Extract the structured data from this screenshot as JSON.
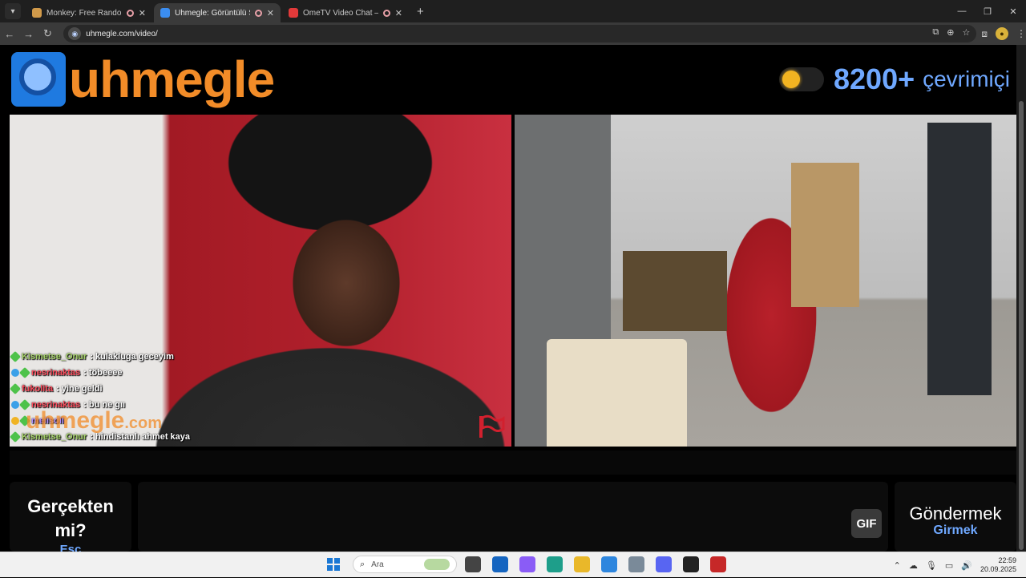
{
  "browser": {
    "tabs": [
      {
        "title": "Monkey: Free Random Vide",
        "favicon_color": "#d19a4a",
        "active": false
      },
      {
        "title": "Uhmegle: Görüntülü Sohbe",
        "favicon_color": "#3b8df0",
        "active": true
      },
      {
        "title": "OmeTV Video Chat — Ome",
        "favicon_color": "#e23a3a",
        "active": false
      }
    ],
    "url": "uhmegle.com/video/"
  },
  "header": {
    "logo_text": "uhmegle",
    "online_count": "8200+",
    "online_label": "çevrimiçi"
  },
  "videos": {
    "left_watermark": "uhmegle",
    "left_watermark_suffix": ".com"
  },
  "chat": [
    {
      "user": "Kismetse_Onur",
      "text": ": kulakluga geceyim"
    },
    {
      "user": "nesrinaktas",
      "text": ": töbeeee"
    },
    {
      "user": "fukolita",
      "text": ": yine geldi"
    },
    {
      "user": "nesrinaktas",
      "text": ": bu ne gıı"
    },
    {
      "user": "melisoll",
      "text": ""
    },
    {
      "user": "Kismetse_Onur",
      "text": ": hindistanlı ahmet kaya"
    }
  ],
  "controls": {
    "esc_title": "Gerçekten mi?",
    "esc_key": "Esc",
    "gif_label": "GIF",
    "send_title": "Göndermek",
    "send_key": "Girmek"
  },
  "taskbar": {
    "search_placeholder": "Ara",
    "time": "22:59",
    "date": "20.09.2025"
  },
  "colors": {
    "brand_orange": "#f28c28",
    "accent_blue": "#6fa8ff",
    "logo_blue": "#1f7ae0"
  }
}
